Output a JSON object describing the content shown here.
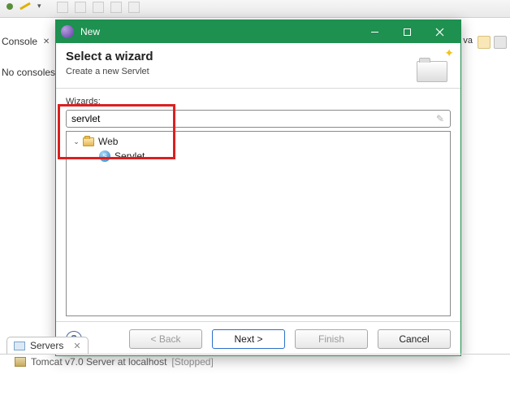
{
  "background": {
    "console_tab": "Console",
    "no_consoles": "No consoles to",
    "pinned_java": "va"
  },
  "dialog": {
    "window_title": "New",
    "heading": "Select a wizard",
    "subheading": "Create a new Servlet",
    "wizards_label": "Wizards:",
    "filter_value": "servlet",
    "tree": {
      "web_label": "Web",
      "servlet_label": "Servlet"
    },
    "buttons": {
      "back": "< Back",
      "next": "Next >",
      "finish": "Finish",
      "cancel": "Cancel"
    }
  },
  "servers": {
    "tab_label": "Servers",
    "row_label": "Tomcat v7.0 Server at localhost",
    "row_status": "[Stopped]"
  }
}
